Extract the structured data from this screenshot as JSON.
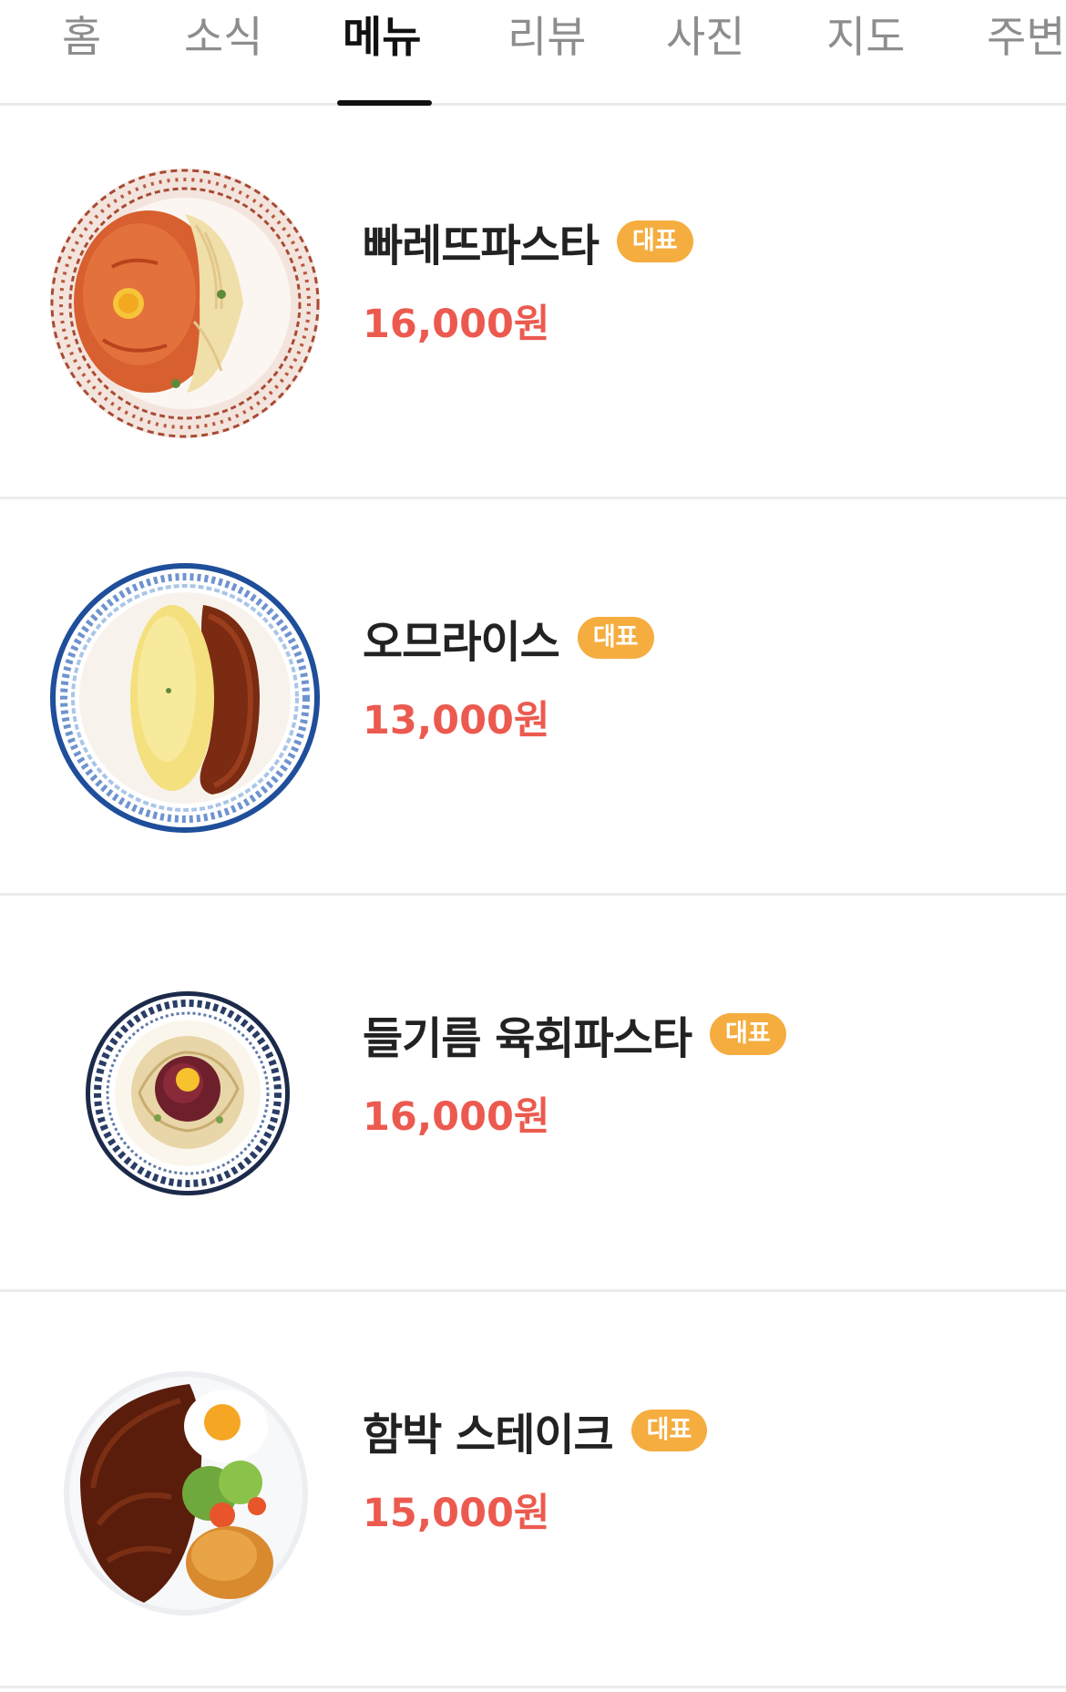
{
  "tabs": [
    {
      "label": "홈"
    },
    {
      "label": "소식"
    },
    {
      "label": "메뉴"
    },
    {
      "label": "리뷰"
    },
    {
      "label": "사진"
    },
    {
      "label": "지도"
    },
    {
      "label": "주변"
    }
  ],
  "active_tab": "메뉴",
  "menu": [
    {
      "name": "빠레뜨파스타",
      "badge": "대표",
      "price": "16,000원"
    },
    {
      "name": "오므라이스",
      "badge": "대표",
      "price": "13,000원"
    },
    {
      "name": "들기름 육회파스타",
      "badge": "대표",
      "price": "16,000원"
    },
    {
      "name": "함박 스테이크",
      "badge": "대표",
      "price": "15,000원"
    }
  ],
  "colors": {
    "active_text": "#111111",
    "inactive_text": "#8d8d8d",
    "badge_bg": "#f5ad3f",
    "price": "#ec5a4f"
  }
}
